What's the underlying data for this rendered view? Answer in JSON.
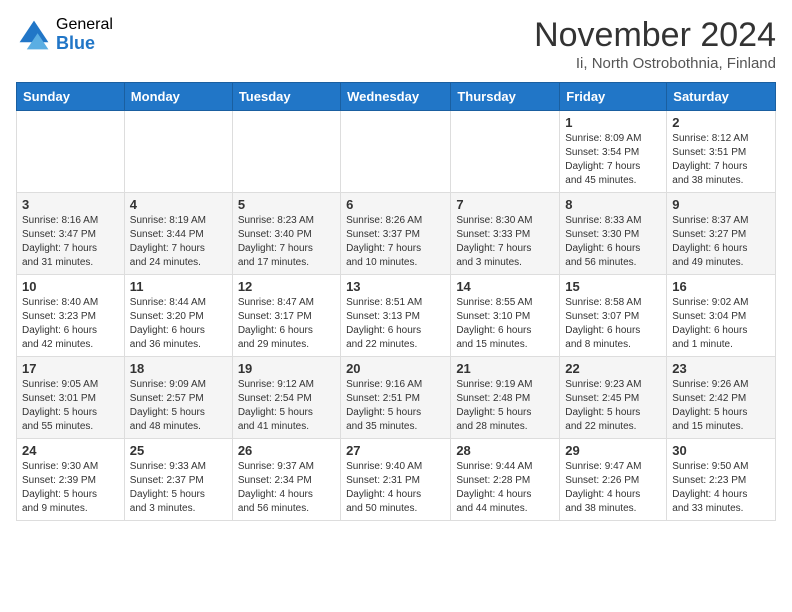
{
  "logo": {
    "general": "General",
    "blue": "Blue"
  },
  "title": "November 2024",
  "subtitle": "Ii, North Ostrobothnia, Finland",
  "days_of_week": [
    "Sunday",
    "Monday",
    "Tuesday",
    "Wednesday",
    "Thursday",
    "Friday",
    "Saturday"
  ],
  "weeks": [
    [
      {
        "day": "",
        "info": ""
      },
      {
        "day": "",
        "info": ""
      },
      {
        "day": "",
        "info": ""
      },
      {
        "day": "",
        "info": ""
      },
      {
        "day": "",
        "info": ""
      },
      {
        "day": "1",
        "info": "Sunrise: 8:09 AM\nSunset: 3:54 PM\nDaylight: 7 hours\nand 45 minutes."
      },
      {
        "day": "2",
        "info": "Sunrise: 8:12 AM\nSunset: 3:51 PM\nDaylight: 7 hours\nand 38 minutes."
      }
    ],
    [
      {
        "day": "3",
        "info": "Sunrise: 8:16 AM\nSunset: 3:47 PM\nDaylight: 7 hours\nand 31 minutes."
      },
      {
        "day": "4",
        "info": "Sunrise: 8:19 AM\nSunset: 3:44 PM\nDaylight: 7 hours\nand 24 minutes."
      },
      {
        "day": "5",
        "info": "Sunrise: 8:23 AM\nSunset: 3:40 PM\nDaylight: 7 hours\nand 17 minutes."
      },
      {
        "day": "6",
        "info": "Sunrise: 8:26 AM\nSunset: 3:37 PM\nDaylight: 7 hours\nand 10 minutes."
      },
      {
        "day": "7",
        "info": "Sunrise: 8:30 AM\nSunset: 3:33 PM\nDaylight: 7 hours\nand 3 minutes."
      },
      {
        "day": "8",
        "info": "Sunrise: 8:33 AM\nSunset: 3:30 PM\nDaylight: 6 hours\nand 56 minutes."
      },
      {
        "day": "9",
        "info": "Sunrise: 8:37 AM\nSunset: 3:27 PM\nDaylight: 6 hours\nand 49 minutes."
      }
    ],
    [
      {
        "day": "10",
        "info": "Sunrise: 8:40 AM\nSunset: 3:23 PM\nDaylight: 6 hours\nand 42 minutes."
      },
      {
        "day": "11",
        "info": "Sunrise: 8:44 AM\nSunset: 3:20 PM\nDaylight: 6 hours\nand 36 minutes."
      },
      {
        "day": "12",
        "info": "Sunrise: 8:47 AM\nSunset: 3:17 PM\nDaylight: 6 hours\nand 29 minutes."
      },
      {
        "day": "13",
        "info": "Sunrise: 8:51 AM\nSunset: 3:13 PM\nDaylight: 6 hours\nand 22 minutes."
      },
      {
        "day": "14",
        "info": "Sunrise: 8:55 AM\nSunset: 3:10 PM\nDaylight: 6 hours\nand 15 minutes."
      },
      {
        "day": "15",
        "info": "Sunrise: 8:58 AM\nSunset: 3:07 PM\nDaylight: 6 hours\nand 8 minutes."
      },
      {
        "day": "16",
        "info": "Sunrise: 9:02 AM\nSunset: 3:04 PM\nDaylight: 6 hours\nand 1 minute."
      }
    ],
    [
      {
        "day": "17",
        "info": "Sunrise: 9:05 AM\nSunset: 3:01 PM\nDaylight: 5 hours\nand 55 minutes."
      },
      {
        "day": "18",
        "info": "Sunrise: 9:09 AM\nSunset: 2:57 PM\nDaylight: 5 hours\nand 48 minutes."
      },
      {
        "day": "19",
        "info": "Sunrise: 9:12 AM\nSunset: 2:54 PM\nDaylight: 5 hours\nand 41 minutes."
      },
      {
        "day": "20",
        "info": "Sunrise: 9:16 AM\nSunset: 2:51 PM\nDaylight: 5 hours\nand 35 minutes."
      },
      {
        "day": "21",
        "info": "Sunrise: 9:19 AM\nSunset: 2:48 PM\nDaylight: 5 hours\nand 28 minutes."
      },
      {
        "day": "22",
        "info": "Sunrise: 9:23 AM\nSunset: 2:45 PM\nDaylight: 5 hours\nand 22 minutes."
      },
      {
        "day": "23",
        "info": "Sunrise: 9:26 AM\nSunset: 2:42 PM\nDaylight: 5 hours\nand 15 minutes."
      }
    ],
    [
      {
        "day": "24",
        "info": "Sunrise: 9:30 AM\nSunset: 2:39 PM\nDaylight: 5 hours\nand 9 minutes."
      },
      {
        "day": "25",
        "info": "Sunrise: 9:33 AM\nSunset: 2:37 PM\nDaylight: 5 hours\nand 3 minutes."
      },
      {
        "day": "26",
        "info": "Sunrise: 9:37 AM\nSunset: 2:34 PM\nDaylight: 4 hours\nand 56 minutes."
      },
      {
        "day": "27",
        "info": "Sunrise: 9:40 AM\nSunset: 2:31 PM\nDaylight: 4 hours\nand 50 minutes."
      },
      {
        "day": "28",
        "info": "Sunrise: 9:44 AM\nSunset: 2:28 PM\nDaylight: 4 hours\nand 44 minutes."
      },
      {
        "day": "29",
        "info": "Sunrise: 9:47 AM\nSunset: 2:26 PM\nDaylight: 4 hours\nand 38 minutes."
      },
      {
        "day": "30",
        "info": "Sunrise: 9:50 AM\nSunset: 2:23 PM\nDaylight: 4 hours\nand 33 minutes."
      }
    ]
  ]
}
